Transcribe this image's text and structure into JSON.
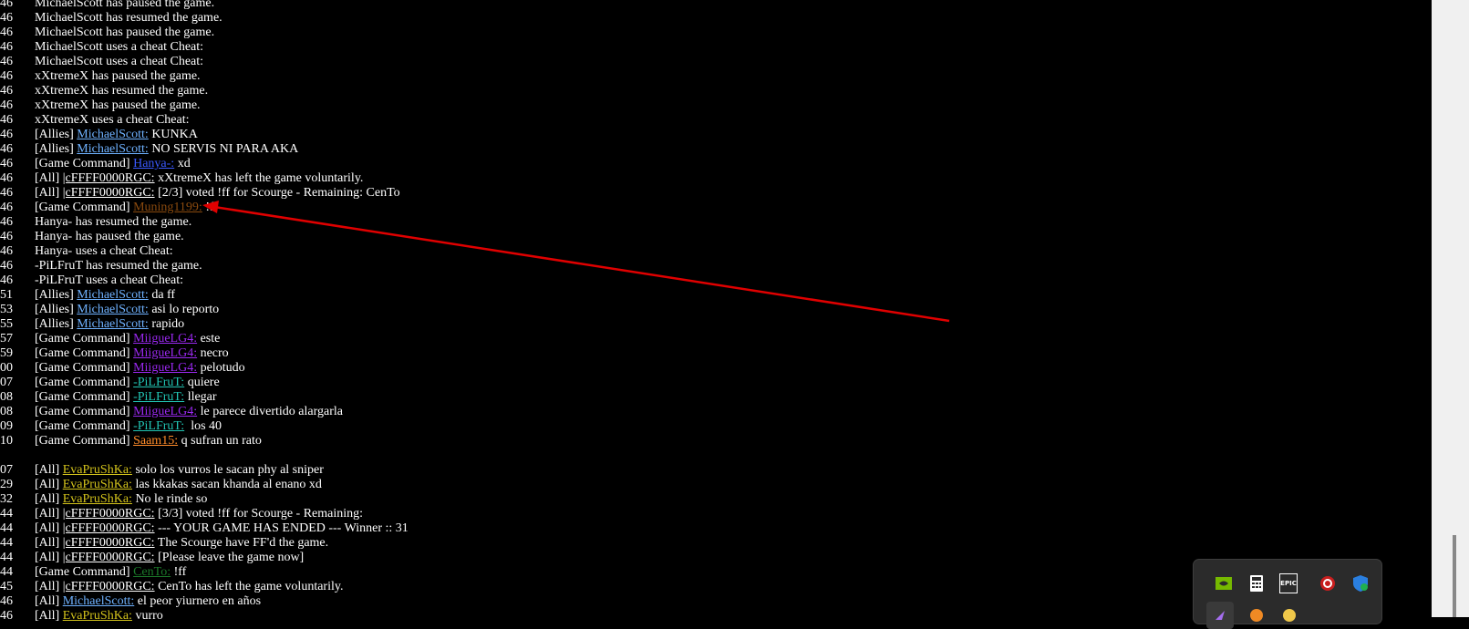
{
  "chat_log": [
    {
      "ts": "46",
      "prefix": "",
      "name": "",
      "name_color": "",
      "text": "MichaelScott has paused the game."
    },
    {
      "ts": "46",
      "prefix": "",
      "name": "",
      "name_color": "",
      "text": "MichaelScott has resumed the game."
    },
    {
      "ts": "46",
      "prefix": "",
      "name": "",
      "name_color": "",
      "text": "MichaelScott has paused the game."
    },
    {
      "ts": "46",
      "prefix": "",
      "name": "",
      "name_color": "",
      "text": "MichaelScott uses a cheat Cheat:"
    },
    {
      "ts": "46",
      "prefix": "",
      "name": "",
      "name_color": "",
      "text": "MichaelScott uses a cheat Cheat:"
    },
    {
      "ts": "46",
      "prefix": "",
      "name": "",
      "name_color": "",
      "text": "xXtremeX has paused the game."
    },
    {
      "ts": "46",
      "prefix": "",
      "name": "",
      "name_color": "",
      "text": "xXtremeX has resumed the game."
    },
    {
      "ts": "46",
      "prefix": "",
      "name": "",
      "name_color": "",
      "text": "xXtremeX has paused the game."
    },
    {
      "ts": "46",
      "prefix": "",
      "name": "",
      "name_color": "",
      "text": "xXtremeX uses a cheat Cheat:"
    },
    {
      "ts": "46",
      "prefix": "[Allies] ",
      "name": "MichaelScott:",
      "name_color": "mscott",
      "text": " KUNKA"
    },
    {
      "ts": "46",
      "prefix": "[Allies] ",
      "name": "MichaelScott:",
      "name_color": "mscott",
      "text": " NO SERVIS NI PARA AKA"
    },
    {
      "ts": "46",
      "prefix": "[Game Command] ",
      "name": "Hanya-:",
      "name_color": "hanya",
      "text": " xd"
    },
    {
      "ts": "46",
      "prefix": "[All] ",
      "name": "|cFFFF0000RGC:",
      "name_color": "rgc",
      "text": " xXtremeX has left the game voluntarily."
    },
    {
      "ts": "46",
      "prefix": "[All] ",
      "name": "|cFFFF0000RGC:",
      "name_color": "rgc",
      "text": " [2/3] voted !ff for Scourge - Remaining: CenTo"
    },
    {
      "ts": "46",
      "prefix": "[Game Command] ",
      "name": "Muning1199:",
      "name_color": "muning",
      "text": " !ff"
    },
    {
      "ts": "46",
      "prefix": "",
      "name": "",
      "name_color": "",
      "text": "Hanya- has resumed the game."
    },
    {
      "ts": "46",
      "prefix": "",
      "name": "",
      "name_color": "",
      "text": "Hanya- has paused the game."
    },
    {
      "ts": "46",
      "prefix": "",
      "name": "",
      "name_color": "",
      "text": "Hanya- uses a cheat Cheat:"
    },
    {
      "ts": "46",
      "prefix": "",
      "name": "",
      "name_color": "",
      "text": "-PiLFruT has resumed the game."
    },
    {
      "ts": "46",
      "prefix": "",
      "name": "",
      "name_color": "",
      "text": "-PiLFruT uses a cheat Cheat:"
    },
    {
      "ts": "51",
      "prefix": "[Allies] ",
      "name": "MichaelScott:",
      "name_color": "mscott",
      "text": " da ff"
    },
    {
      "ts": "53",
      "prefix": "[Allies] ",
      "name": "MichaelScott:",
      "name_color": "mscott",
      "text": " asi lo reporto"
    },
    {
      "ts": "55",
      "prefix": "[Allies] ",
      "name": "MichaelScott:",
      "name_color": "mscott",
      "text": " rapido"
    },
    {
      "ts": "57",
      "prefix": "[Game Command] ",
      "name": "MiigueLG4:",
      "name_color": "miigue",
      "text": " este"
    },
    {
      "ts": "59",
      "prefix": "[Game Command] ",
      "name": "MiigueLG4:",
      "name_color": "miigue",
      "text": " necro"
    },
    {
      "ts": "00",
      "prefix": "[Game Command] ",
      "name": "MiigueLG4:",
      "name_color": "miigue",
      "text": " pelotudo"
    },
    {
      "ts": "07",
      "prefix": "[Game Command] ",
      "name": "-PiLFruT:",
      "name_color": "pilfrut",
      "text": " quiere"
    },
    {
      "ts": "08",
      "prefix": "[Game Command] ",
      "name": "-PiLFruT:",
      "name_color": "pilfrut",
      "text": " llegar"
    },
    {
      "ts": "08",
      "prefix": "[Game Command] ",
      "name": "MiigueLG4:",
      "name_color": "miigue",
      "text": " le parece divertido alargarla"
    },
    {
      "ts": "09",
      "prefix": "[Game Command] ",
      "name": "-PiLFruT:",
      "name_color": "pilfrut",
      "text": "  los 40"
    },
    {
      "ts": "10",
      "prefix": "[Game Command] ",
      "name": "Saam15:",
      "name_color": "saam",
      "text": " q sufran un rato"
    },
    {
      "ts": "",
      "prefix": "",
      "name": "",
      "name_color": "",
      "text": ""
    },
    {
      "ts": "07",
      "prefix": "[All] ",
      "name": "EvaPruShKa:",
      "name_color": "eva",
      "text": " solo los vurros le sacan phy al sniper"
    },
    {
      "ts": "29",
      "prefix": "[All] ",
      "name": "EvaPruShKa:",
      "name_color": "eva",
      "text": " las kkakas sacan khanda al enano xd"
    },
    {
      "ts": "32",
      "prefix": "[All] ",
      "name": "EvaPruShKa:",
      "name_color": "eva",
      "text": " No le rinde so"
    },
    {
      "ts": "44",
      "prefix": "[All] ",
      "name": "|cFFFF0000RGC:",
      "name_color": "rgc",
      "text": " [3/3] voted !ff for Scourge - Remaining:"
    },
    {
      "ts": "44",
      "prefix": "[All] ",
      "name": "|cFFFF0000RGC:",
      "name_color": "rgc",
      "text": " --- YOUR GAME HAS ENDED --- Winner :: 31"
    },
    {
      "ts": "44",
      "prefix": "[All] ",
      "name": "|cFFFF0000RGC:",
      "name_color": "rgc",
      "text": " The Scourge have FF'd the game."
    },
    {
      "ts": "44",
      "prefix": "[All] ",
      "name": "|cFFFF0000RGC:",
      "name_color": "rgc",
      "text": " [Please leave the game now]"
    },
    {
      "ts": "44",
      "prefix": "[Game Command] ",
      "name": "CenTo:",
      "name_color": "cento",
      "text": " !ff"
    },
    {
      "ts": "45",
      "prefix": "[All] ",
      "name": "|cFFFF0000RGC:",
      "name_color": "rgc",
      "text": " CenTo has left the game voluntarily."
    },
    {
      "ts": "46",
      "prefix": "[All] ",
      "name": "MichaelScott:",
      "name_color": "mscott",
      "text": " el peor yiurnero en años"
    },
    {
      "ts": "46",
      "prefix": "[All] ",
      "name": "EvaPruShKa:",
      "name_color": "eva",
      "text": " vurro"
    }
  ],
  "annotation": {
    "color": "#e00000"
  },
  "tray": {
    "icons": [
      {
        "name": "nvidia-icon",
        "label": ""
      },
      {
        "name": "calculator-icon",
        "label": ""
      },
      {
        "name": "epic-games-icon",
        "label": "EPIC"
      },
      {
        "name": "app-red-icon",
        "label": ""
      },
      {
        "name": "windows-security-icon",
        "label": ""
      },
      {
        "name": "app-purple-icon",
        "label": ""
      },
      {
        "name": "app-orange-icon",
        "label": ""
      },
      {
        "name": "app-yellow-icon",
        "label": ""
      }
    ]
  }
}
